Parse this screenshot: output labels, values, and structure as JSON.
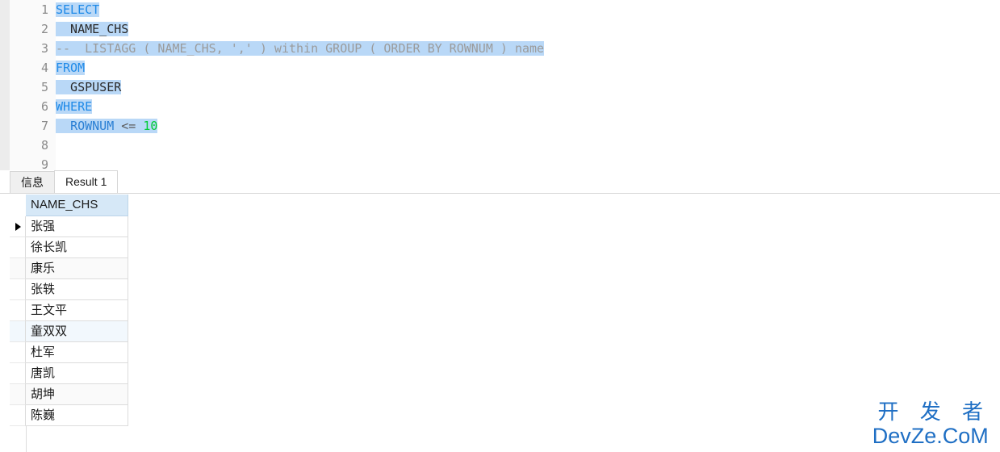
{
  "editor": {
    "gutter_numbers": [
      "1",
      "2",
      "3",
      "4",
      "5",
      "6",
      "7",
      "8",
      "9"
    ],
    "lines": [
      {
        "number": "1",
        "text": "SELECT"
      },
      {
        "number": "2",
        "text": "  NAME_CHS"
      },
      {
        "number": "3",
        "text": "--  LISTAGG ( NAME_CHS, ',' ) within GROUP ( ORDER BY ROWNUM ) name"
      },
      {
        "number": "4",
        "text": "FROM"
      },
      {
        "number": "5",
        "text": "  GSPUSER"
      },
      {
        "number": "6",
        "text": "WHERE"
      },
      {
        "number": "7",
        "text": "  ROWNUM <= 10"
      },
      {
        "number": "8",
        "text": ""
      },
      {
        "number": "9",
        "text": ""
      }
    ],
    "tokens": {
      "select": "SELECT",
      "name_chs": "NAME_CHS",
      "comment": "--  LISTAGG ( NAME_CHS, ',' ) within GROUP ( ORDER BY ROWNUM ) name",
      "from": "FROM",
      "gspuser": "GSPUSER",
      "where": "WHERE",
      "rownum": "ROWNUM",
      "operator": "<=",
      "limit": "10"
    },
    "colors": {
      "keyword": "#1f8ae8",
      "identifier": "#2c2c2c",
      "column": "#2a7fd4",
      "number": "#00cc33",
      "comment": "#9b9b9b",
      "selection": "#b9d8f7"
    }
  },
  "tabs": [
    {
      "label": "信息",
      "active": false
    },
    {
      "label": "Result 1",
      "active": true
    }
  ],
  "grid": {
    "column_header": "NAME_CHS",
    "header_color": "#d6e8f7",
    "rows": [
      {
        "name": "张强",
        "current": true,
        "highlight": false
      },
      {
        "name": "徐长凯",
        "current": false,
        "highlight": false
      },
      {
        "name": "康乐",
        "current": false,
        "highlight": false
      },
      {
        "name": "张轶",
        "current": false,
        "highlight": false
      },
      {
        "name": "王文平",
        "current": false,
        "highlight": false
      },
      {
        "name": "童双双",
        "current": false,
        "highlight": true
      },
      {
        "name": "杜军",
        "current": false,
        "highlight": false
      },
      {
        "name": "唐凯",
        "current": false,
        "highlight": false
      },
      {
        "name": "胡坤",
        "current": false,
        "highlight": false
      },
      {
        "name": "陈巍",
        "current": false,
        "highlight": false
      }
    ]
  },
  "watermark": {
    "cn": "开 发 者",
    "en": "DevZe.CoM",
    "color": "#1f6fc4"
  }
}
